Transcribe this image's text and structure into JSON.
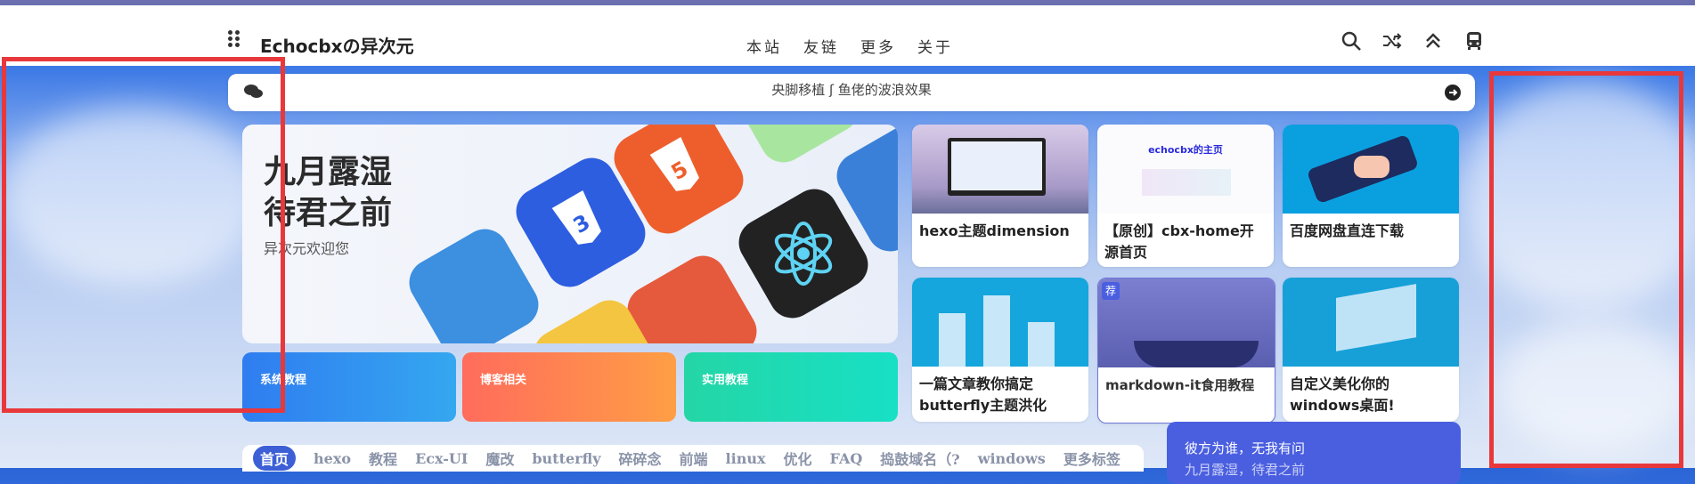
{
  "site": {
    "title": "Echocbxの异次元"
  },
  "nav": {
    "items": [
      "本站",
      "友链",
      "更多",
      "关于"
    ]
  },
  "header_icons": [
    "search-icon",
    "random-icon",
    "back-to-top-icon",
    "travel-icon"
  ],
  "bulletin": {
    "text": "央脚移植 ʃ 鱼佬的波浪效果",
    "next_text": ""
  },
  "hero": {
    "title_line1": "九月露湿",
    "title_line2": "待君之前",
    "subtitle": "异次元欢迎您"
  },
  "categories": [
    {
      "label": "系统教程",
      "color_start": "#2f7df0",
      "color_end": "#35a7f0"
    },
    {
      "label": "博客相关",
      "color_start": "#ff6c5c",
      "color_end": "#ff9e45"
    },
    {
      "label": "实用教程",
      "color_start": "#24d6a6",
      "color_end": "#17e0c5"
    }
  ],
  "cards": [
    {
      "title": "hexo主题dimension"
    },
    {
      "title": "【原创】cbx-home开源首页",
      "image_caption": "echocbx的主页"
    },
    {
      "title": "百度网盘直连下载"
    },
    {
      "title": "一篇文章教你搞定butterfly主题洪化"
    },
    {
      "title": "markdown-it食用教程",
      "badge": "荐"
    },
    {
      "title": "自定义美化你的windows桌面!"
    }
  ],
  "tags": [
    "首页",
    "hexo",
    "教程",
    "Ecx-UI",
    "魔改",
    "butterfly",
    "碎碎念",
    "前端",
    "linux",
    "优化",
    "FAQ",
    "捣鼓域名（?",
    "windows",
    "更多标签"
  ],
  "promo": {
    "line1": "彼方为谁，无我有问",
    "line2": "九月露湿，待君之前"
  },
  "colors": {
    "accent": "#3d5fd6",
    "promo": "#4a5fe0",
    "highlight_box": "#e8383b"
  }
}
